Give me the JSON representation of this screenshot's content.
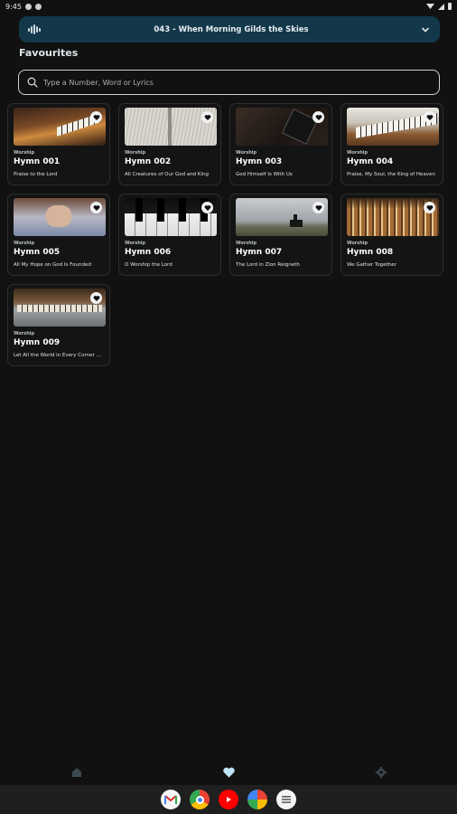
{
  "status_bar": {
    "time": "9:45"
  },
  "now_playing": {
    "title": "043 - When Morning Gilds the Skies",
    "wave_icon": "audio-wave-icon",
    "chevron_icon": "chevron-down-icon"
  },
  "section": {
    "title": "Favourites"
  },
  "search": {
    "placeholder": "Type a Number, Word or Lyrics",
    "icon": "search-icon"
  },
  "hymns": [
    {
      "category": "Worship",
      "name": "Hymn 001",
      "subtitle": "Praise to the Lord"
    },
    {
      "category": "Worship",
      "name": "Hymn 002",
      "subtitle": "All Creatures of Our God and King"
    },
    {
      "category": "Worship",
      "name": "Hymn 003",
      "subtitle": "God Himself Is With Us"
    },
    {
      "category": "Worship",
      "name": "Hymn 004",
      "subtitle": "Praise, My Soul, the King of Heaven"
    },
    {
      "category": "Worship",
      "name": "Hymn 005",
      "subtitle": "All My Hope on God Is Founded"
    },
    {
      "category": "Worship",
      "name": "Hymn 006",
      "subtitle": "O Worship the Lord"
    },
    {
      "category": "Worship",
      "name": "Hymn 007",
      "subtitle": "The Lord in Zion Reigneth"
    },
    {
      "category": "Worship",
      "name": "Hymn 008",
      "subtitle": "We Gather Together"
    },
    {
      "category": "Worship",
      "name": "Hymn 009",
      "subtitle": "Let All the World in Every Corner Sing"
    }
  ],
  "bottom_nav": [
    {
      "icon": "home-icon",
      "active": false
    },
    {
      "icon": "heart-icon",
      "active": true
    },
    {
      "icon": "gear-icon",
      "active": false
    }
  ],
  "dock": [
    {
      "icon": "gmail-icon"
    },
    {
      "icon": "chrome-icon"
    },
    {
      "icon": "youtube-icon"
    },
    {
      "icon": "photos-icon"
    },
    {
      "icon": "app-drawer-icon"
    }
  ],
  "colors": {
    "background": "#111111",
    "accent_bar": "#13384a",
    "active_nav": "#bfe3f5",
    "inactive_nav": "#3b4a52"
  }
}
